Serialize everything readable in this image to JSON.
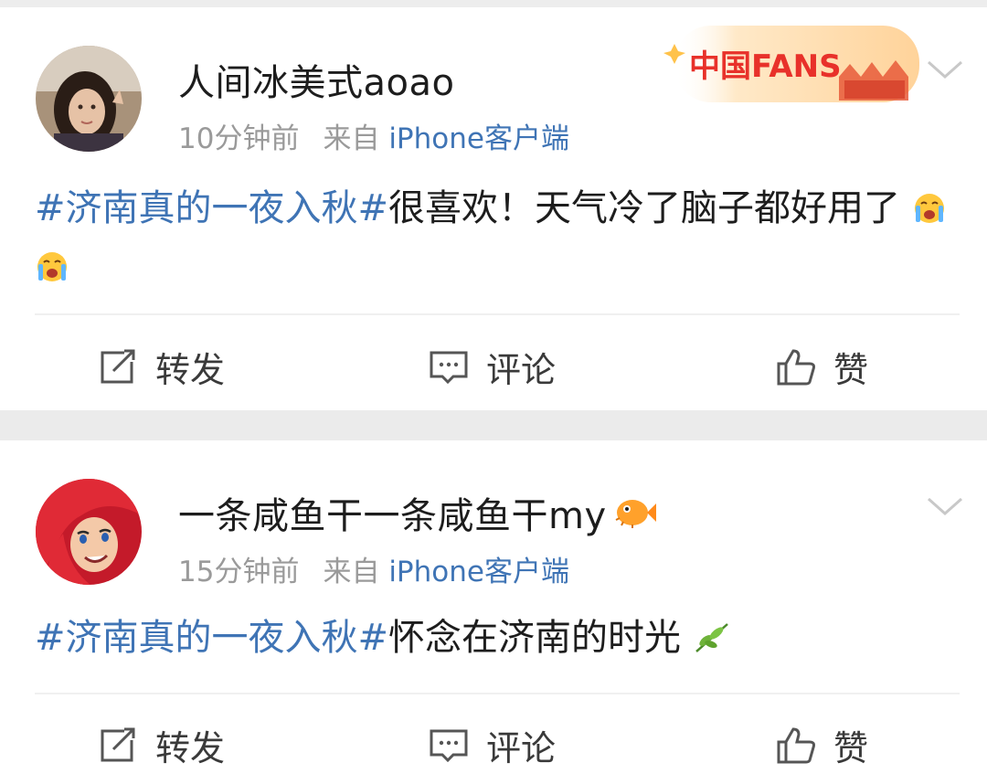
{
  "posts": [
    {
      "username": "人间冰美式aoao",
      "time": "10分钟前",
      "source_prefix": "来自",
      "source": "iPhone客户端",
      "topic": "#济南真的一夜入秋#",
      "body": "很喜欢！天气冷了脑子都好用了",
      "badge": "中国FANS",
      "actions": {
        "repost": "转发",
        "comment": "评论",
        "like": "赞"
      }
    },
    {
      "username": "一条咸鱼干一条咸鱼干my",
      "time": "15分钟前",
      "source_prefix": "来自",
      "source": "iPhone客户端",
      "topic": "#济南真的一夜入秋#",
      "body": "怀念在济南的时光",
      "actions": {
        "repost": "转发",
        "comment": "评论",
        "like": "赞"
      }
    }
  ],
  "icons": {
    "more": "chevron-down-icon",
    "repost": "share-icon",
    "comment": "comment-icon",
    "like": "thumbs-up-icon"
  },
  "colors": {
    "topic": "#3f74b5",
    "meta": "#9a9a9a",
    "text": "#1d1d1d"
  }
}
